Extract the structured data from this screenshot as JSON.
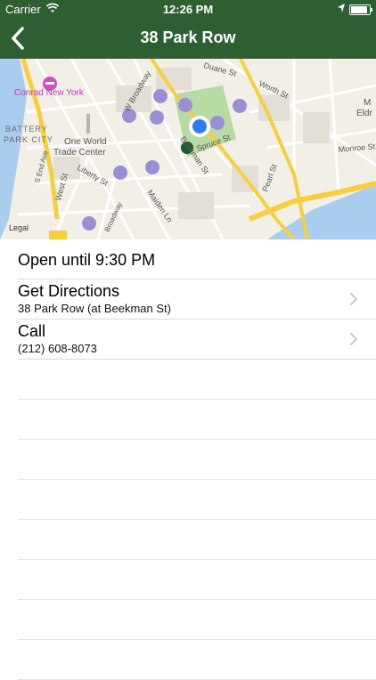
{
  "status_bar": {
    "carrier": "Carrier",
    "time": "12:26 PM"
  },
  "nav": {
    "title": "38 Park Row",
    "back_icon": "chevron-left-icon"
  },
  "map": {
    "labels": {
      "conrad": "Conrad New York",
      "battery_park_city": "BATTERY PARK CITY",
      "one_world_trade_center": "One World Trade Center",
      "w_broadway": "W Broadway",
      "duane_st": "Duane St",
      "worth_st": "Worth St",
      "spruce_st": "Spruce St",
      "beekman_st": "Beekman St",
      "liberty_st": "Liberty St",
      "west_st": "West St",
      "s_end_ave": "S End Ave",
      "broadway": "Broadway",
      "maiden_ln": "Maiden Ln",
      "monroe_st": "Monroe St",
      "pearl_st": "Pearl St",
      "m_partial": "M",
      "eldr_partial": "Eldr",
      "legal": "Legal"
    },
    "colors": {
      "land": "#f2efe7",
      "water": "#a9cdee",
      "park": "#b7dba2",
      "highway": "#f6cf3f",
      "user_dot": "#2e7cf6",
      "pin": "#1c5d2e",
      "transit": "#9b8fd3"
    }
  },
  "list": {
    "hours": "Open until 9:30 PM",
    "directions_title": "Get Directions",
    "directions_subtitle": "38 Park Row (at Beekman St)",
    "call_title": "Call",
    "call_subtitle": "(212) 608-8073"
  },
  "theme": {
    "nav_bg": "#2d5f32",
    "separator": "#d9d9d9",
    "chevron": "#c7c7cc"
  }
}
